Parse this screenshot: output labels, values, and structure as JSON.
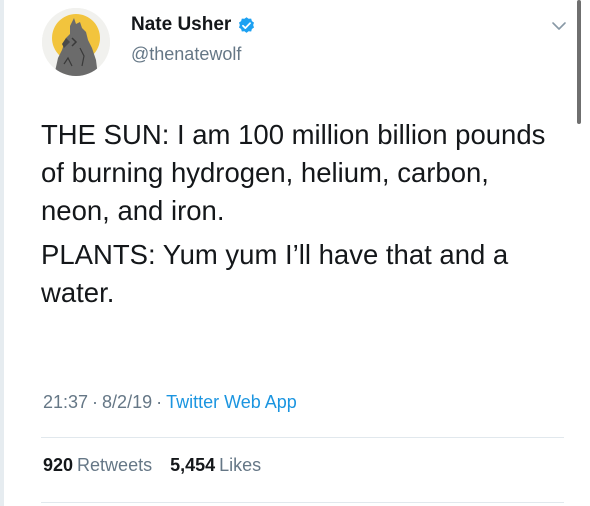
{
  "author": {
    "display_name": "Nate Usher",
    "handle": "@thenatewolf",
    "verified_icon": "verified-badge-icon",
    "avatar_icon": "howling-wolf-avatar"
  },
  "tweet": {
    "paragraphs": [
      "THE SUN: I am 100 million billion pounds of burning hydrogen, helium, carbon, neon, and iron.",
      "PLANTS: Yum yum I’ll have that and a water."
    ],
    "time": "21:37",
    "date": "8/2/19",
    "separator": "·",
    "source": "Twitter Web App"
  },
  "stats": {
    "retweets_count": "920",
    "retweets_label": "Retweets",
    "likes_count": "5,454",
    "likes_label": "Likes"
  },
  "colors": {
    "text": "#14171a",
    "secondary": "#657786",
    "link": "#1b95e0",
    "verified": "#1da1f2",
    "divider": "#e1e8ed"
  }
}
